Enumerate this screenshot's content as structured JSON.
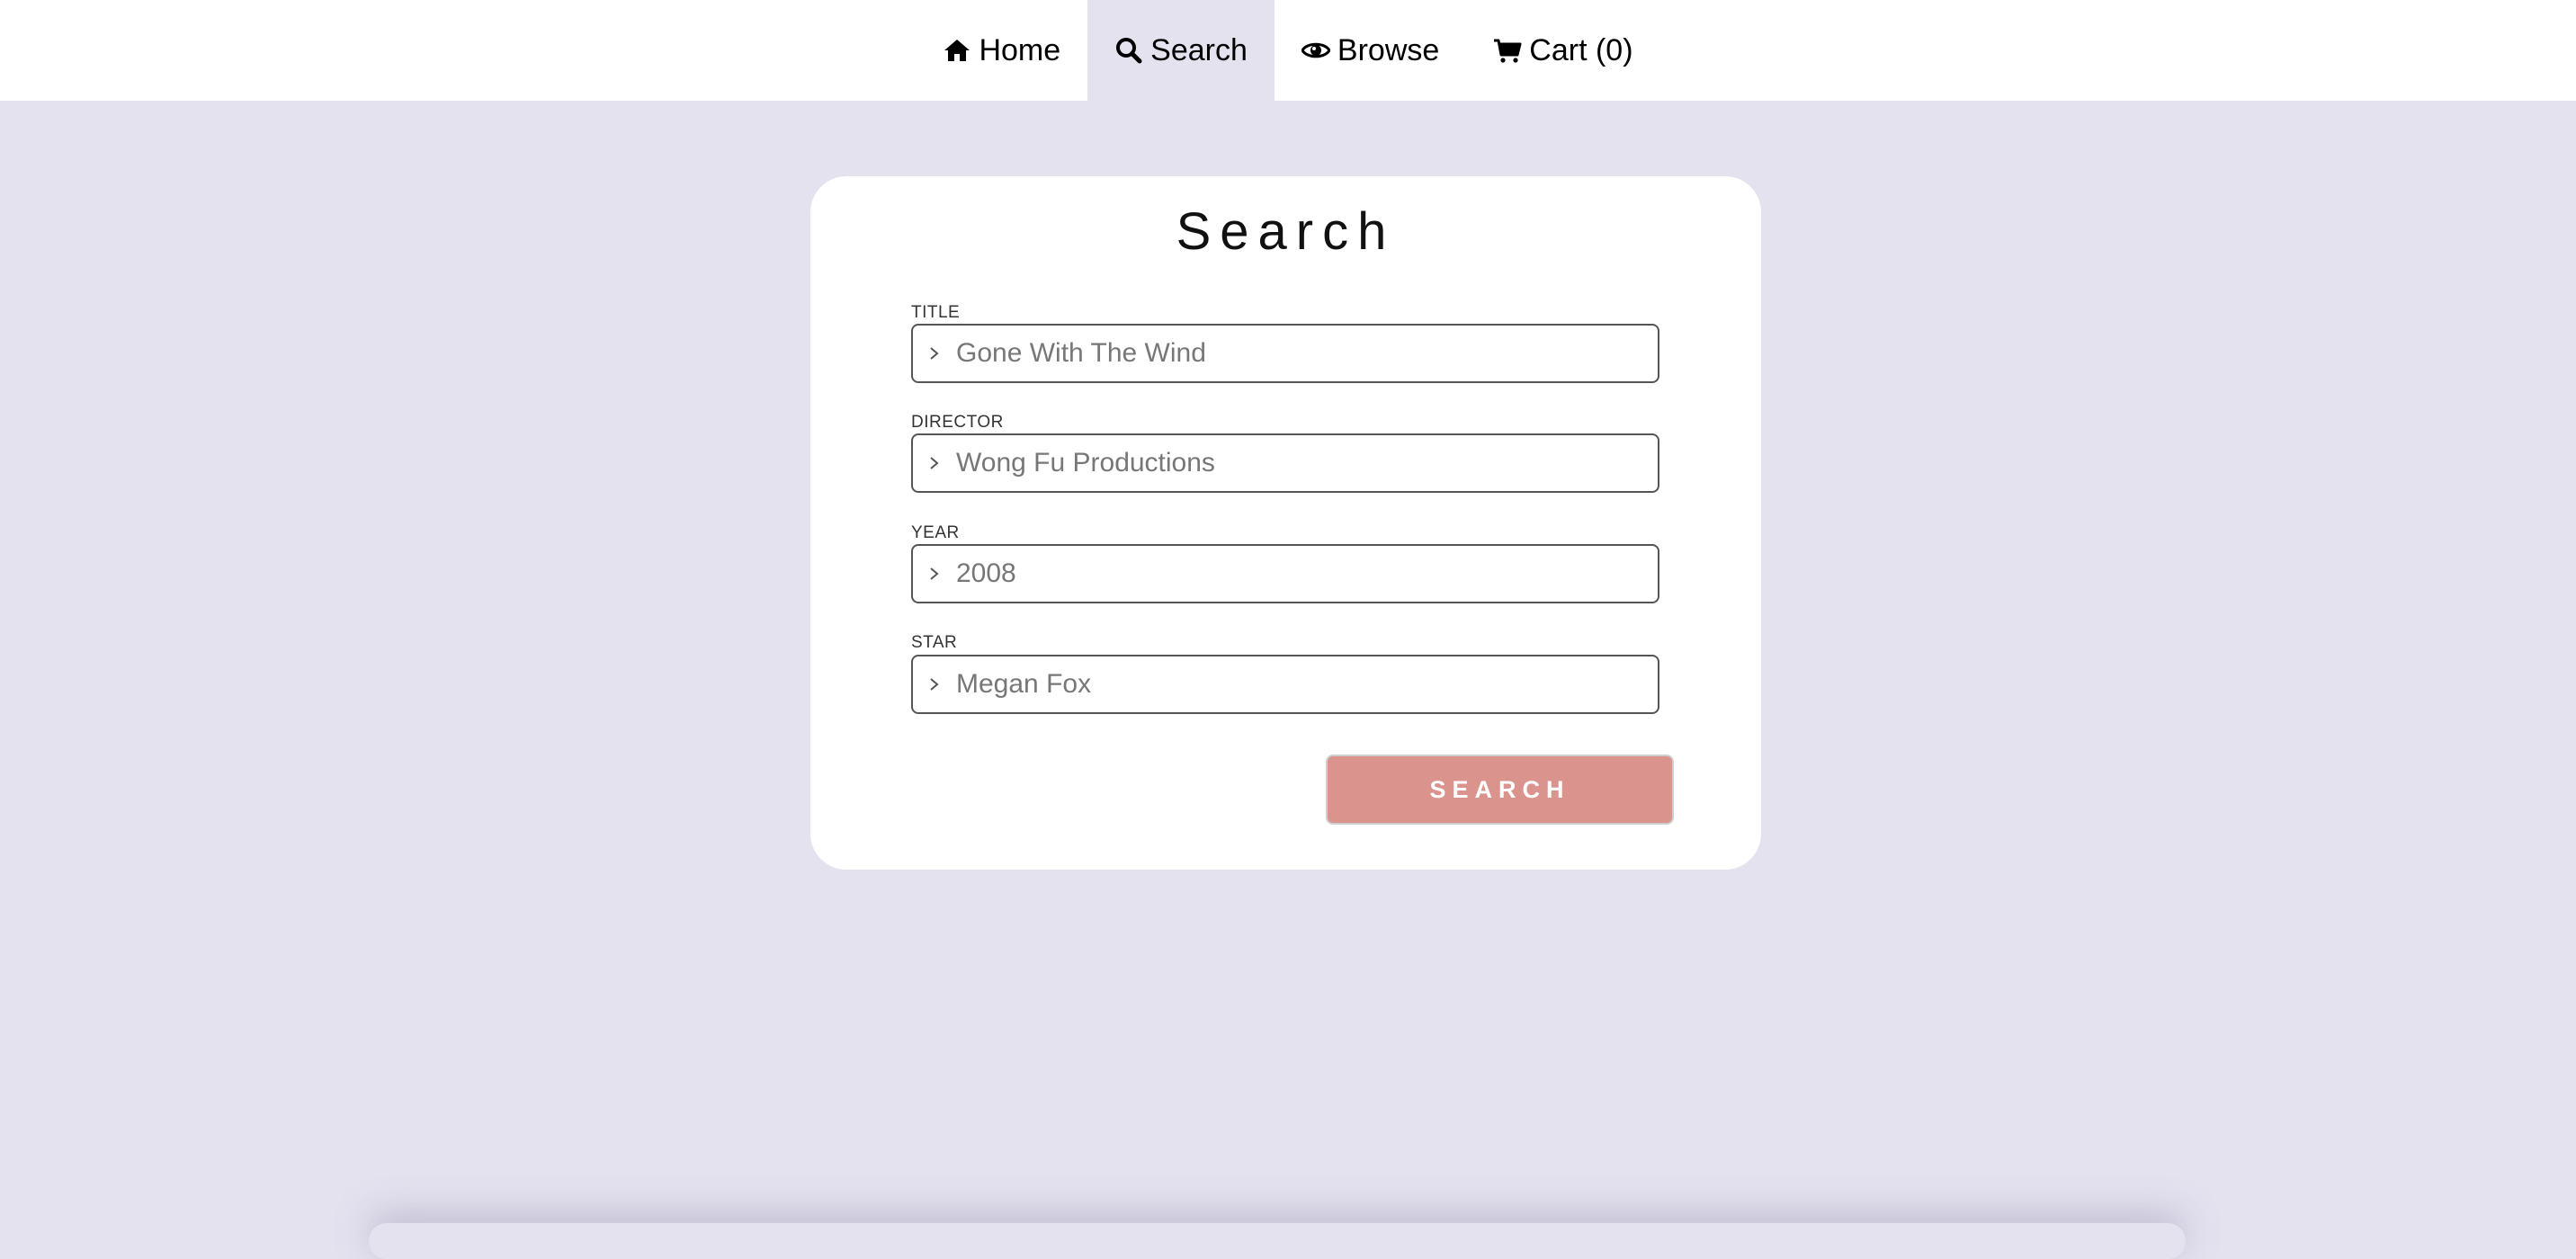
{
  "nav": {
    "items": [
      {
        "label": "Home",
        "icon": "home-icon"
      },
      {
        "label": "Search",
        "icon": "search-icon",
        "active": true
      },
      {
        "label": "Browse",
        "icon": "eye-icon"
      },
      {
        "label": "Cart (0)",
        "icon": "cart-icon"
      }
    ]
  },
  "search_form": {
    "title": "Search",
    "fields": [
      {
        "label": "TITLE",
        "placeholder": "Gone With The Wind"
      },
      {
        "label": "DIRECTOR",
        "placeholder": "Wong Fu Productions"
      },
      {
        "label": "YEAR",
        "placeholder": "2008"
      },
      {
        "label": "STAR",
        "placeholder": "Megan Fox"
      }
    ],
    "submit_label": "SEARCH"
  },
  "colors": {
    "page_background": "#e4e2ef",
    "card_background": "#ffffff",
    "button_background": "#da948d"
  }
}
